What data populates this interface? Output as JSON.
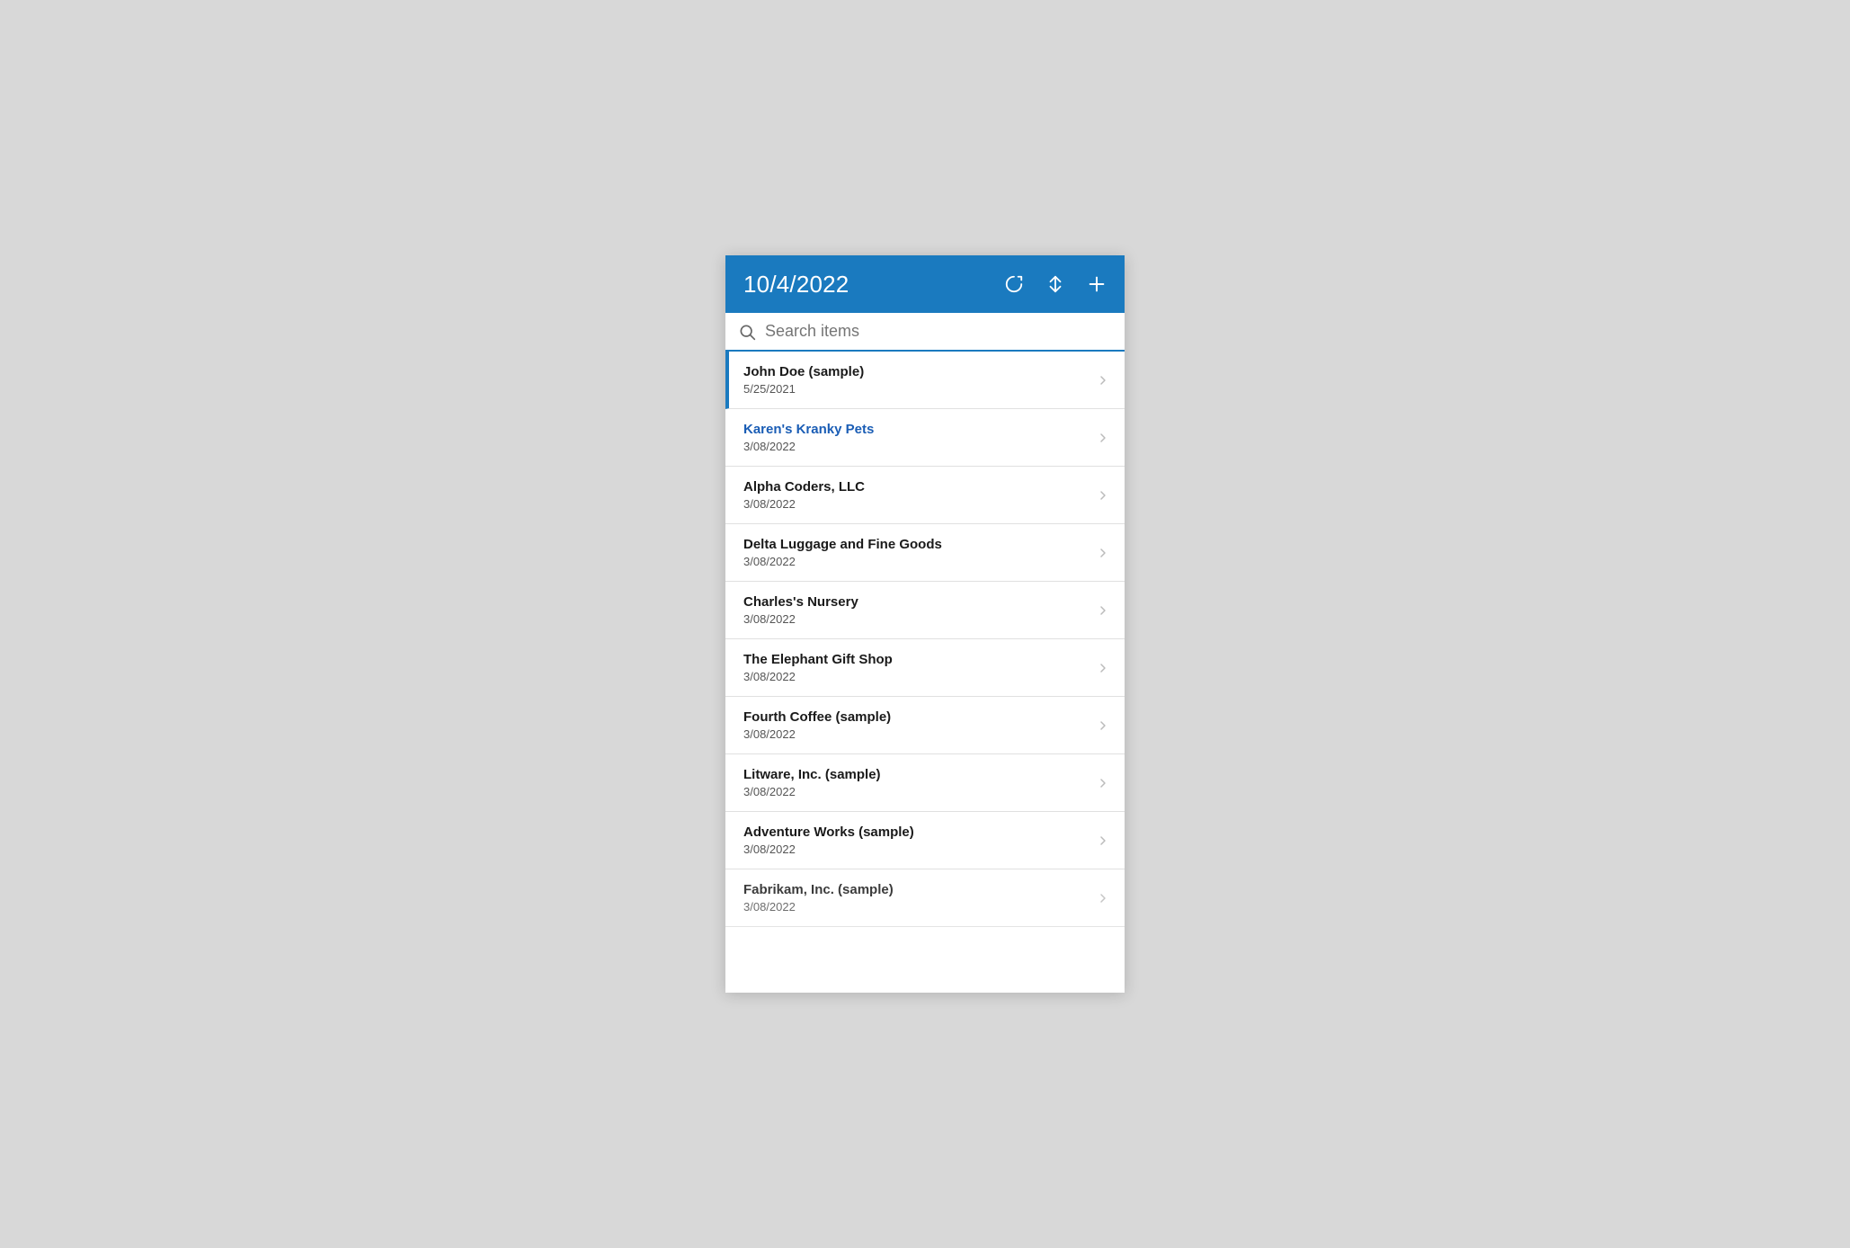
{
  "header": {
    "title": "10/4/2022",
    "refresh_icon": "refresh-icon",
    "sort_icon": "sort-icon",
    "add_icon": "add-icon"
  },
  "search": {
    "placeholder": "Search items",
    "value": ""
  },
  "list": {
    "items": [
      {
        "id": 1,
        "name": "John Doe (sample)",
        "date": "5/25/2021",
        "active": true,
        "link": false
      },
      {
        "id": 2,
        "name": "Karen's Kranky Pets",
        "date": "3/08/2022",
        "active": false,
        "link": true
      },
      {
        "id": 3,
        "name": "Alpha Coders, LLC",
        "date": "3/08/2022",
        "active": false,
        "link": false
      },
      {
        "id": 4,
        "name": "Delta Luggage and Fine Goods",
        "date": "3/08/2022",
        "active": false,
        "link": false
      },
      {
        "id": 5,
        "name": "Charles's Nursery",
        "date": "3/08/2022",
        "active": false,
        "link": false
      },
      {
        "id": 6,
        "name": "The Elephant Gift Shop",
        "date": "3/08/2022",
        "active": false,
        "link": false
      },
      {
        "id": 7,
        "name": "Fourth Coffee (sample)",
        "date": "3/08/2022",
        "active": false,
        "link": false
      },
      {
        "id": 8,
        "name": "Litware, Inc. (sample)",
        "date": "3/08/2022",
        "active": false,
        "link": false
      },
      {
        "id": 9,
        "name": "Adventure Works (sample)",
        "date": "3/08/2022",
        "active": false,
        "link": false
      },
      {
        "id": 10,
        "name": "Fabrikam, Inc. (sample)",
        "date": "3/08/2022",
        "active": false,
        "link": false,
        "partial": true
      }
    ]
  }
}
